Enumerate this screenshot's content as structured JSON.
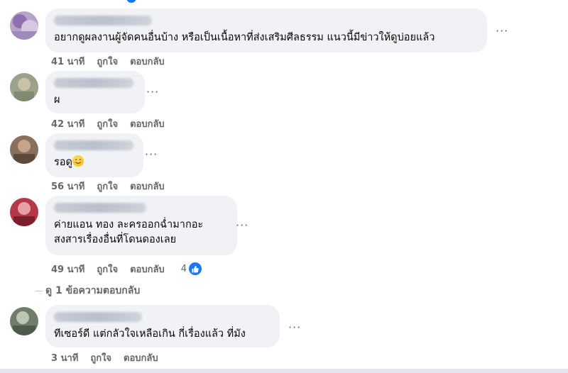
{
  "top_fragment": {
    "time": "",
    "like": "",
    "reply": ""
  },
  "comments": [
    {
      "text_lines": [
        "อยากดูผลงานผู้จัดคนอื่นบ้าง หรือเป็นเนื้อหาที่ส่งเสริมศีลธรรม แนวนี้มีข่าวให้ดูบ่อยแล้ว"
      ],
      "time": "41 นาที",
      "like": "ถูกใจ",
      "reply": "ตอบกลับ",
      "reaction_count": ""
    },
    {
      "text_lines": [
        "ผ"
      ],
      "time": "42 นาที",
      "like": "ถูกใจ",
      "reply": "ตอบกลับ",
      "reaction_count": ""
    },
    {
      "text_lines": [
        "รอดู"
      ],
      "emoji": "smiling-face-icon",
      "time": "56 นาที",
      "like": "ถูกใจ",
      "reply": "ตอบกลับ",
      "reaction_count": ""
    },
    {
      "text_lines": [
        "ค่ายแอน ทอง ละครออกฉ่ำมากอะ",
        "สงสารเรื่องอื่นที่โดนดองเลย"
      ],
      "time": "49 นาที",
      "like": "ถูกใจ",
      "reply": "ตอบกลับ",
      "reaction_count": "4"
    },
    {
      "text_lines": [
        "ทีเซอร์ดี แต่กลัวใจเหลือเกิน กี่เรื่องแล้ว ที่มัง"
      ],
      "time": "3 นาที",
      "like": "ถูกใจ",
      "reply": "ตอบกลับ",
      "reaction_count": ""
    }
  ],
  "view_replies": "ดู 1 ข้อความตอบกลับ",
  "more_label": "···",
  "colors": {
    "bubble": "#f0f2f5",
    "meta_text": "#65676b",
    "like_blue": "#1877f2"
  }
}
